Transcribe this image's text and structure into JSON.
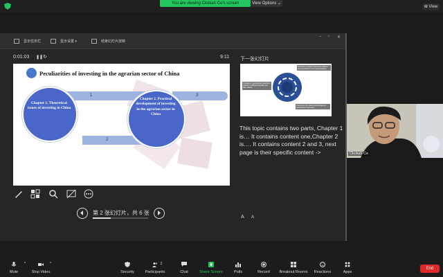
{
  "meeting": {
    "banner": "You are viewing Ckokah Ce's screen",
    "view_options": "View Options ⌄",
    "view_button": "View"
  },
  "ppt_toolbar": {
    "items": [
      "显示任务栏",
      "显示设置 ▾",
      "结束幻灯片放映"
    ]
  },
  "presenter": {
    "timer": "0:01:03",
    "clock": "9:11",
    "next_label": "下一张幻灯片",
    "page_info": "第 2 张幻灯片，共 6 张",
    "progress": 0.33,
    "notes": "This topic contains two parts, Chapter 1 is… It contains content one,Chapter 2 is…. It contains content 2 and 3, next page is their specific content  ->",
    "font_big": "A",
    "font_small": "A"
  },
  "slide": {
    "title": "Peculiarities of investing in the agrarian sector of China",
    "chapter1": "Chapter 1. Theoretical issues of investing in China",
    "chapter2": "Chapter 2. Practical development of investing in the agrarian sector in China",
    "bar1": "1",
    "bar2": "2",
    "bar3": "3"
  },
  "next_slide": {
    "box1": "Directions of state investment policies and mechanisms for implementation",
    "box2": "Changes in agricultural investment policies in different periods and their effects",
    "box3": "Comments the status and changes of agricultural investment"
  },
  "video": {
    "name": "Ckokah Ce"
  },
  "toolbar": {
    "mute": "Mute",
    "stop_video": "Stop Video",
    "security": "Security",
    "participants": "Participants",
    "participants_count": "2",
    "chat": "Chat",
    "share_screen": "Share Screen",
    "polls": "Polls",
    "record": "Record",
    "breakout": "Breakout Rooms",
    "reactions": "Reactions",
    "apps": "Apps",
    "end": "End"
  },
  "colors": {
    "banner": "#23c55e",
    "end": "#e02828",
    "circle": "#4a66c8",
    "bar": "#9db3e0"
  }
}
